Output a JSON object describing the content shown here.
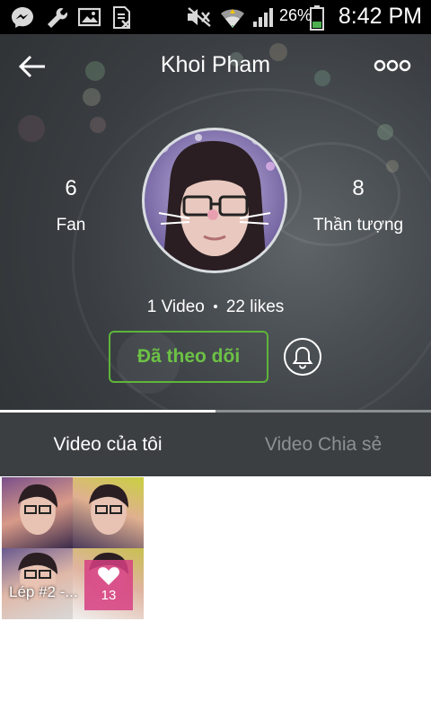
{
  "status_bar": {
    "battery": "26%",
    "time": "8:42 PM",
    "icons": [
      "messenger-icon",
      "wrench-icon",
      "image-icon",
      "sim-blocked-icon",
      "mute-icon",
      "wifi-icon",
      "signal-icon",
      "battery-icon"
    ]
  },
  "header": {
    "title": "Khoi Pham",
    "back_icon": "back-arrow-icon",
    "more_icon": "more-icon"
  },
  "profile": {
    "fan_count": "6",
    "fan_label": "Fan",
    "idol_count": "8",
    "idol_label": "Thần tượng",
    "video_count": "1 Video",
    "likes": "22 likes",
    "follow_label": "Đã theo dõi",
    "bell_icon": "bell-icon"
  },
  "tabs": [
    {
      "label": "Video của tôi",
      "active": true
    },
    {
      "label": "Video Chia sẻ",
      "active": false
    }
  ],
  "videos": [
    {
      "title": "Lép #2 -...",
      "likes": "13"
    }
  ],
  "colors": {
    "accent_green": "#5db53a",
    "tab_bar": "#3b3f42",
    "like_badge": "#d64082"
  }
}
